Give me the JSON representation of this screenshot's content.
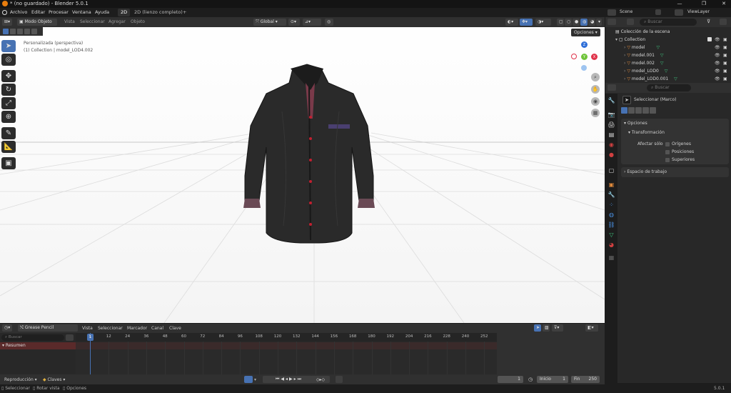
{
  "titlebar": {
    "title": "* (no guardado) - Blender 5.0.1"
  },
  "menubar": {
    "items": [
      "Archivo",
      "Editar",
      "Procesar",
      "Ventana",
      "Ayuda"
    ],
    "workspaces": [
      "2D",
      "2D (lienzo completo)"
    ],
    "add": "+"
  },
  "outliner_top": {
    "scene": "Scene",
    "viewlayer": "ViewLayer"
  },
  "viewport": {
    "mode": "Modo Objeto",
    "menus": [
      "Vista",
      "Seleccionar",
      "Agregar",
      "Objeto"
    ],
    "transform": "Global",
    "options": "Opciones",
    "overlay_line1": "Personalizada (perspectiva)",
    "overlay_line2": "(1) Collection | model_LOD4.002",
    "gizmo": {
      "z": "Z",
      "y": "Y",
      "x": "X"
    }
  },
  "outliner": {
    "search_placeholder": "Buscar",
    "root": "Colección de la escena",
    "collection": "Collection",
    "objects": [
      "model",
      "model.001",
      "model.002",
      "model_LOD0",
      "model_LOD0.001"
    ]
  },
  "properties": {
    "search_placeholder": "Buscar",
    "tool_name": "Seleccionar (Marco)",
    "options_label": "Opciones",
    "transform_label": "Transformación",
    "affect_label": "Afectar sólo",
    "checks": [
      "Orígenes",
      "Posiciones",
      "Superiores"
    ],
    "workspace_label": "Espacio de trabajo"
  },
  "timeline": {
    "editor": "Grease Pencil",
    "menus": [
      "Vista",
      "Seleccionar",
      "Marcador",
      "Canal",
      "Clave"
    ],
    "search_placeholder": "Buscar",
    "summary": "Resumen",
    "ticks": [
      "1",
      "12",
      "24",
      "36",
      "48",
      "60",
      "72",
      "84",
      "96",
      "108",
      "120",
      "132",
      "144",
      "156",
      "168",
      "180",
      "192",
      "204",
      "216",
      "228",
      "240",
      "252"
    ],
    "playback": "Reproducción",
    "keys": "Claves",
    "current_frame": "1",
    "start_label": "Inicio",
    "start": "1",
    "end_label": "Fin",
    "end": "250"
  },
  "statusbar": {
    "items": [
      "Seleccionar",
      "Rotar vista",
      "Opciones"
    ],
    "version": "5.0.1"
  },
  "colors": {
    "accent": "#4772b3",
    "object": "#e08a3c",
    "mesh": "#3fc47f"
  }
}
